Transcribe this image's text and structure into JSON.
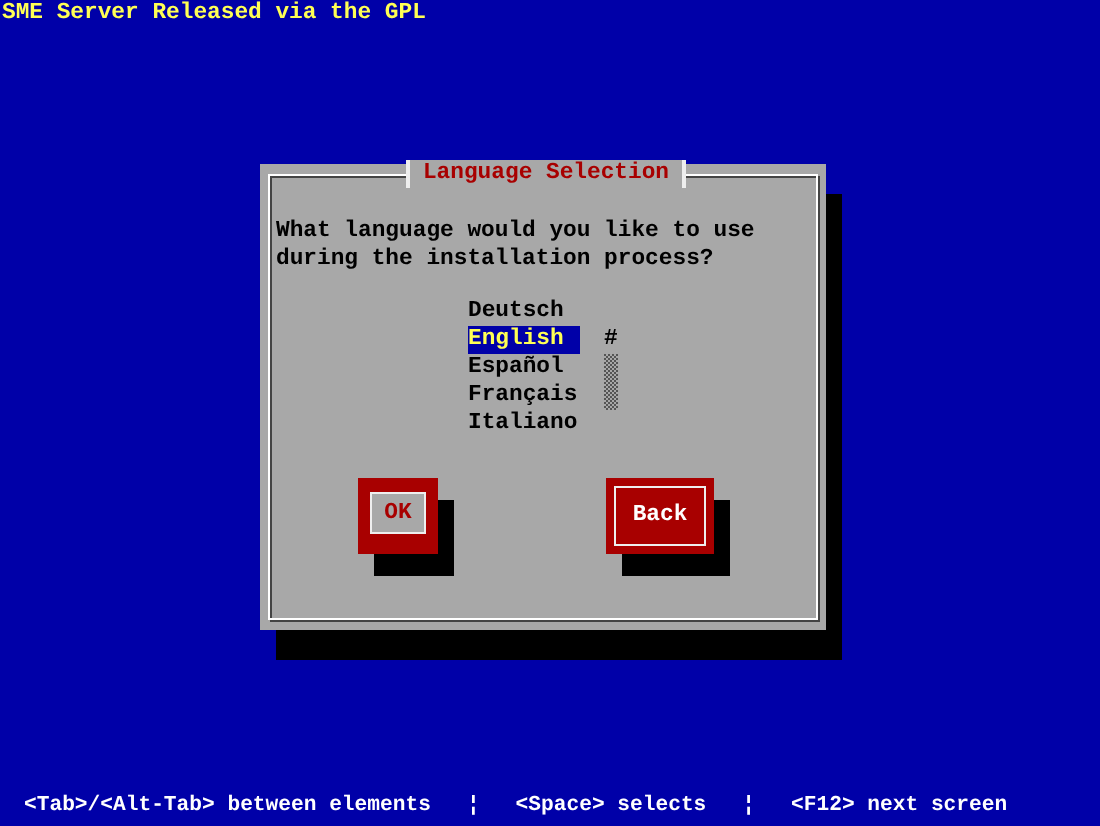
{
  "header": {
    "title": "SME Server Released via the GPL"
  },
  "dialog": {
    "title": "Language Selection",
    "prompt": "What language would you like to use during the installation process?",
    "languages": [
      {
        "label": "Deutsch",
        "selected": false
      },
      {
        "label": "English",
        "selected": true
      },
      {
        "label": "Español",
        "selected": false
      },
      {
        "label": "Français",
        "selected": false
      },
      {
        "label": "Italiano",
        "selected": false
      }
    ],
    "scroll_mark": "#",
    "buttons": [
      {
        "label": "OK",
        "focused": true
      },
      {
        "label": "Back",
        "focused": false
      }
    ]
  },
  "footer": [
    "<Tab>/<Alt-Tab> between elements",
    "¦",
    "<Space> selects",
    "¦",
    "<F12> next screen"
  ]
}
